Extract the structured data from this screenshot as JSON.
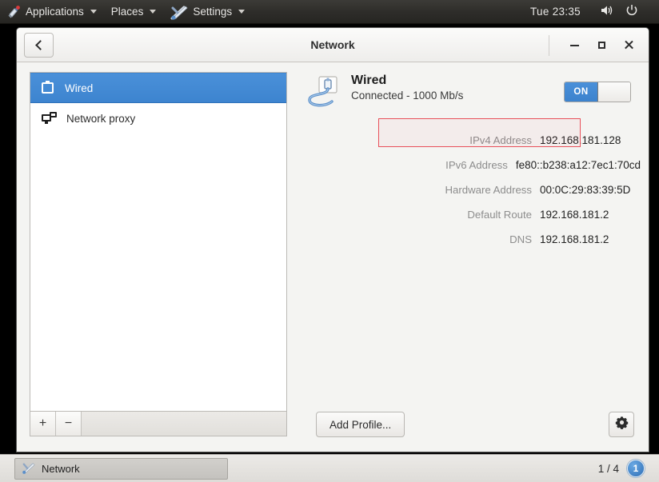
{
  "top_panel": {
    "menus": [
      {
        "label": "Applications",
        "icon": "applications-icon",
        "has_caret": true
      },
      {
        "label": "Places",
        "icon": "",
        "has_caret": true
      },
      {
        "label": "Settings",
        "icon": "settings-tools-icon",
        "has_caret": true
      }
    ],
    "clock": "Tue 23:35",
    "volume_icon": "speaker-icon",
    "power_icon": "power-icon",
    "caret_icon": "chevron-down-icon"
  },
  "window": {
    "title": "Network",
    "back_label": "‹",
    "controls": {
      "minimize": "minimize-icon",
      "maximize": "maximize-icon",
      "close": "close-icon"
    }
  },
  "sidebar": {
    "items": [
      {
        "label": "Wired",
        "icon": "wired-icon",
        "selected": true
      },
      {
        "label": "Network proxy",
        "icon": "network-proxy-icon",
        "selected": false
      }
    ],
    "toolbar": {
      "add_label": "+",
      "remove_label": "−"
    }
  },
  "details": {
    "device_name": "Wired",
    "device_status": "Connected - 1000 Mb/s",
    "device_icon": "ethernet-cable-icon",
    "toggle": {
      "state_label": "ON",
      "enabled": true
    },
    "rows": [
      {
        "label": "IPv4 Address",
        "value": "192.168.181.128",
        "highlighted": true
      },
      {
        "label": "IPv6 Address",
        "value": "fe80::b238:a12:7ec1:70cd",
        "highlighted": false
      },
      {
        "label": "Hardware Address",
        "value": "00:0C:29:83:39:5D",
        "highlighted": false
      },
      {
        "label": "Default Route",
        "value": "192.168.181.2",
        "highlighted": false
      },
      {
        "label": "DNS",
        "value": "192.168.181.2",
        "highlighted": false
      }
    ],
    "highlight_color": "#e8505a"
  },
  "actions": {
    "add_profile_label": "Add Profile...",
    "settings_icon": "gear-icon"
  },
  "bottom_panel": {
    "task_label": "Network",
    "task_icon": "settings-tools-icon",
    "workspace_count": "1 / 4",
    "workspace_badge": "1"
  },
  "colors": {
    "accent": "#4a90d9",
    "highlight": "#e8505a",
    "panel_dark": "#2e2d2a"
  }
}
